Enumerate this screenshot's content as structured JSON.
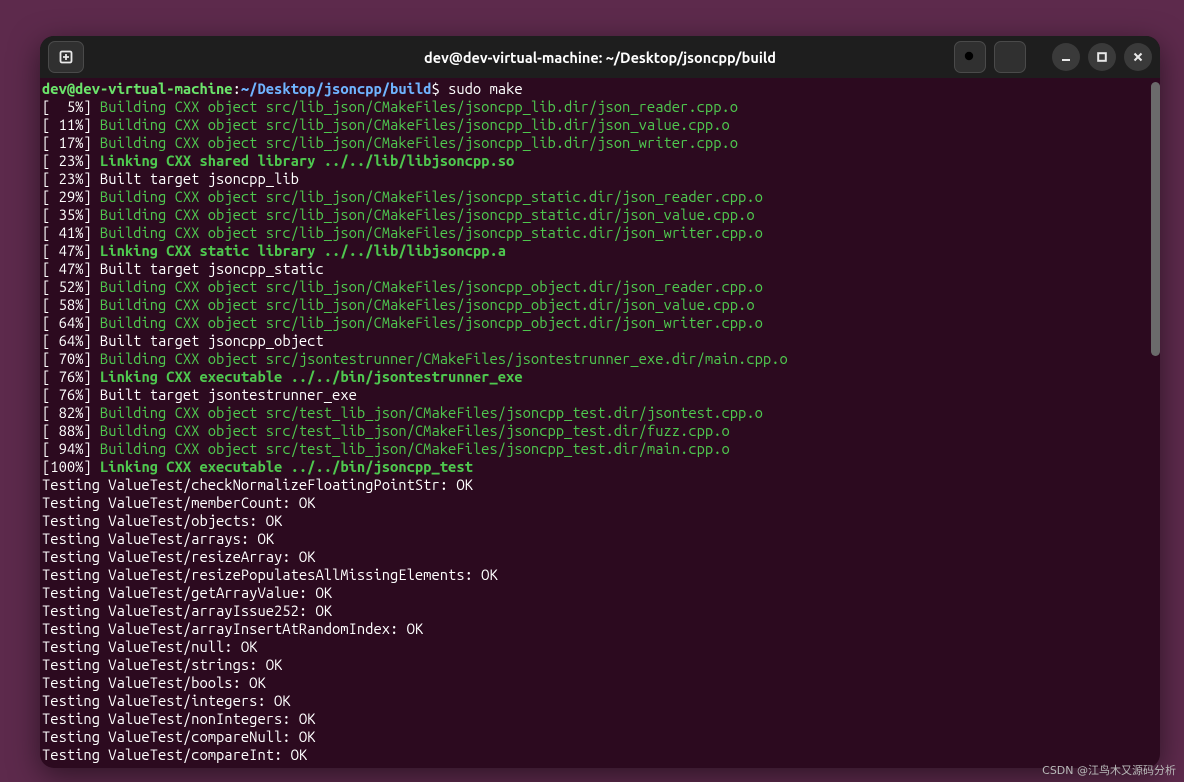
{
  "window": {
    "title": "dev@dev-virtual-machine: ~/Desktop/jsoncpp/build"
  },
  "prompt": {
    "user": "dev@dev-virtual-machine",
    "sep1": ":",
    "path": "~/Desktop/jsoncpp/build",
    "sep2": "$ ",
    "command": "sudo make"
  },
  "lines": [
    {
      "pct": "[  5%] ",
      "msg": "Building CXX object src/lib_json/CMakeFiles/jsoncpp_lib.dir/json_reader.cpp.o",
      "cls": "g"
    },
    {
      "pct": "[ 11%] ",
      "msg": "Building CXX object src/lib_json/CMakeFiles/jsoncpp_lib.dir/json_value.cpp.o",
      "cls": "g"
    },
    {
      "pct": "[ 17%] ",
      "msg": "Building CXX object src/lib_json/CMakeFiles/jsoncpp_lib.dir/json_writer.cpp.o",
      "cls": "g"
    },
    {
      "pct": "[ 23%] ",
      "msg": "Linking CXX shared library ../../lib/libjsoncpp.so",
      "cls": "gb"
    },
    {
      "pct": "[ 23%] ",
      "msg": "Built target jsoncpp_lib",
      "cls": "w"
    },
    {
      "pct": "[ 29%] ",
      "msg": "Building CXX object src/lib_json/CMakeFiles/jsoncpp_static.dir/json_reader.cpp.o",
      "cls": "g"
    },
    {
      "pct": "[ 35%] ",
      "msg": "Building CXX object src/lib_json/CMakeFiles/jsoncpp_static.dir/json_value.cpp.o",
      "cls": "g"
    },
    {
      "pct": "[ 41%] ",
      "msg": "Building CXX object src/lib_json/CMakeFiles/jsoncpp_static.dir/json_writer.cpp.o",
      "cls": "g"
    },
    {
      "pct": "[ 47%] ",
      "msg": "Linking CXX static library ../../lib/libjsoncpp.a",
      "cls": "gb"
    },
    {
      "pct": "[ 47%] ",
      "msg": "Built target jsoncpp_static",
      "cls": "w"
    },
    {
      "pct": "[ 52%] ",
      "msg": "Building CXX object src/lib_json/CMakeFiles/jsoncpp_object.dir/json_reader.cpp.o",
      "cls": "g"
    },
    {
      "pct": "[ 58%] ",
      "msg": "Building CXX object src/lib_json/CMakeFiles/jsoncpp_object.dir/json_value.cpp.o",
      "cls": "g"
    },
    {
      "pct": "[ 64%] ",
      "msg": "Building CXX object src/lib_json/CMakeFiles/jsoncpp_object.dir/json_writer.cpp.o",
      "cls": "g"
    },
    {
      "pct": "[ 64%] ",
      "msg": "Built target jsoncpp_object",
      "cls": "w"
    },
    {
      "pct": "[ 70%] ",
      "msg": "Building CXX object src/jsontestrunner/CMakeFiles/jsontestrunner_exe.dir/main.cpp.o",
      "cls": "g"
    },
    {
      "pct": "[ 76%] ",
      "msg": "Linking CXX executable ../../bin/jsontestrunner_exe",
      "cls": "gb"
    },
    {
      "pct": "[ 76%] ",
      "msg": "Built target jsontestrunner_exe",
      "cls": "w"
    },
    {
      "pct": "[ 82%] ",
      "msg": "Building CXX object src/test_lib_json/CMakeFiles/jsoncpp_test.dir/jsontest.cpp.o",
      "cls": "g"
    },
    {
      "pct": "[ 88%] ",
      "msg": "Building CXX object src/test_lib_json/CMakeFiles/jsoncpp_test.dir/fuzz.cpp.o",
      "cls": "g"
    },
    {
      "pct": "[ 94%] ",
      "msg": "Building CXX object src/test_lib_json/CMakeFiles/jsoncpp_test.dir/main.cpp.o",
      "cls": "g"
    },
    {
      "pct": "[100%] ",
      "msg": "Linking CXX executable ../../bin/jsoncpp_test",
      "cls": "gb"
    },
    {
      "pct": "",
      "msg": "Testing ValueTest/checkNormalizeFloatingPointStr: OK",
      "cls": "w"
    },
    {
      "pct": "",
      "msg": "Testing ValueTest/memberCount: OK",
      "cls": "w"
    },
    {
      "pct": "",
      "msg": "Testing ValueTest/objects: OK",
      "cls": "w"
    },
    {
      "pct": "",
      "msg": "Testing ValueTest/arrays: OK",
      "cls": "w"
    },
    {
      "pct": "",
      "msg": "Testing ValueTest/resizeArray: OK",
      "cls": "w"
    },
    {
      "pct": "",
      "msg": "Testing ValueTest/resizePopulatesAllMissingElements: OK",
      "cls": "w"
    },
    {
      "pct": "",
      "msg": "Testing ValueTest/getArrayValue: OK",
      "cls": "w"
    },
    {
      "pct": "",
      "msg": "Testing ValueTest/arrayIssue252: OK",
      "cls": "w"
    },
    {
      "pct": "",
      "msg": "Testing ValueTest/arrayInsertAtRandomIndex: OK",
      "cls": "w"
    },
    {
      "pct": "",
      "msg": "Testing ValueTest/null: OK",
      "cls": "w"
    },
    {
      "pct": "",
      "msg": "Testing ValueTest/strings: OK",
      "cls": "w"
    },
    {
      "pct": "",
      "msg": "Testing ValueTest/bools: OK",
      "cls": "w"
    },
    {
      "pct": "",
      "msg": "Testing ValueTest/integers: OK",
      "cls": "w"
    },
    {
      "pct": "",
      "msg": "Testing ValueTest/nonIntegers: OK",
      "cls": "w"
    },
    {
      "pct": "",
      "msg": "Testing ValueTest/compareNull: OK",
      "cls": "w"
    },
    {
      "pct": "",
      "msg": "Testing ValueTest/compareInt: OK",
      "cls": "w"
    }
  ],
  "watermark": "CSDN @江鸟木又源码分析"
}
